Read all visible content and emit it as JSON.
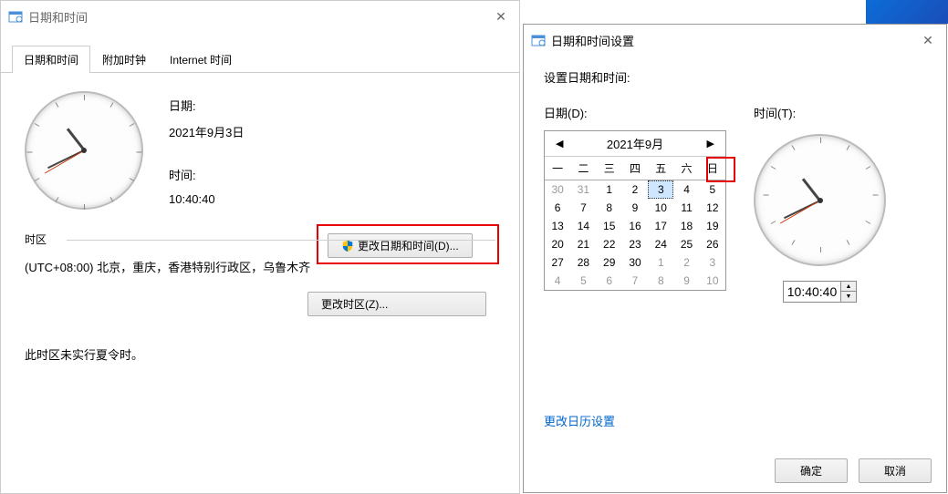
{
  "win1": {
    "title": "日期和时间",
    "tabs": [
      "日期和时间",
      "附加时钟",
      "Internet 时间"
    ],
    "active_tab": 0,
    "date_label": "日期:",
    "date_value": "2021年9月3日",
    "time_label": "时间:",
    "time_value": "10:40:40",
    "change_datetime_btn": "更改日期和时间(D)...",
    "tz_section": "时区",
    "tz_value": "(UTC+08:00) 北京，重庆，香港特别行政区，乌鲁木齐",
    "change_tz_btn": "更改时区(Z)...",
    "dst_note": "此时区未实行夏令时。"
  },
  "win2": {
    "title": "日期和时间设置",
    "heading": "设置日期和时间:",
    "date_label": "日期(D):",
    "time_label": "时间(T):",
    "cal_title": "2021年9月",
    "day_headers": [
      "一",
      "二",
      "三",
      "四",
      "五",
      "六",
      "日"
    ],
    "weeks": [
      [
        {
          "d": "30",
          "o": true
        },
        {
          "d": "31",
          "o": true
        },
        {
          "d": "1"
        },
        {
          "d": "2"
        },
        {
          "d": "3",
          "sel": true
        },
        {
          "d": "4"
        },
        {
          "d": "5"
        }
      ],
      [
        {
          "d": "6"
        },
        {
          "d": "7"
        },
        {
          "d": "8"
        },
        {
          "d": "9"
        },
        {
          "d": "10"
        },
        {
          "d": "11"
        },
        {
          "d": "12"
        }
      ],
      [
        {
          "d": "13"
        },
        {
          "d": "14"
        },
        {
          "d": "15"
        },
        {
          "d": "16"
        },
        {
          "d": "17"
        },
        {
          "d": "18"
        },
        {
          "d": "19"
        }
      ],
      [
        {
          "d": "20"
        },
        {
          "d": "21"
        },
        {
          "d": "22"
        },
        {
          "d": "23"
        },
        {
          "d": "24"
        },
        {
          "d": "25"
        },
        {
          "d": "26"
        }
      ],
      [
        {
          "d": "27"
        },
        {
          "d": "28"
        },
        {
          "d": "29"
        },
        {
          "d": "30"
        },
        {
          "d": "1",
          "o": true
        },
        {
          "d": "2",
          "o": true
        },
        {
          "d": "3",
          "o": true
        }
      ],
      [
        {
          "d": "4",
          "o": true
        },
        {
          "d": "5",
          "o": true
        },
        {
          "d": "6",
          "o": true
        },
        {
          "d": "7",
          "o": true
        },
        {
          "d": "8",
          "o": true
        },
        {
          "d": "9",
          "o": true
        },
        {
          "d": "10",
          "o": true
        }
      ]
    ],
    "time_value": "10:40:40",
    "calendar_link": "更改日历设置",
    "ok_btn": "确定",
    "cancel_btn": "取消"
  }
}
